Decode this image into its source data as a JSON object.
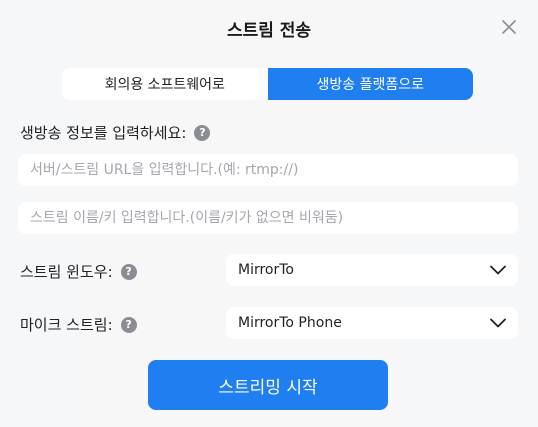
{
  "dialog": {
    "title": "스트림 전송"
  },
  "tabs": [
    {
      "label": "회의용 소프트웨어로",
      "active": false
    },
    {
      "label": "생방송 플랫폼으로",
      "active": true
    }
  ],
  "stream_info": {
    "label": "생방송 정보를 입력하세요:",
    "server_url_placeholder": "서버/스트림 URL을 입력합니다.(예: rtmp://)",
    "stream_key_placeholder": "스트림 이름/키 입력합니다.(이름/키가 없으면 비워둠)"
  },
  "stream_window": {
    "label": "스트림 윈도우:",
    "selected": "MirrorTo"
  },
  "mic_stream": {
    "label": "마이크 스트림:",
    "selected": "MirrorTo Phone"
  },
  "start_button": {
    "label": "스트리밍 시작"
  },
  "help_glyph": "?",
  "colors": {
    "accent": "#1f7ef0",
    "help_icon": "#8a8d93"
  }
}
